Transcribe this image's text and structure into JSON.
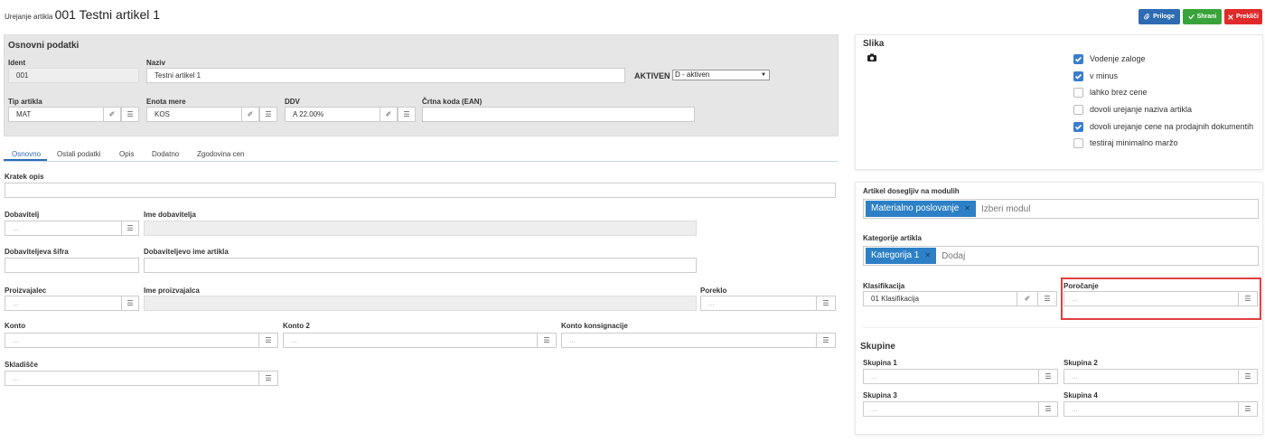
{
  "header": {
    "subtitle": "Urejanje artikla",
    "title": "001 Testni artikel 1"
  },
  "toolbar": {
    "attachments": "Priloge",
    "save": "Shrani",
    "cancel": "Prekliči"
  },
  "colors": {
    "blue": "#2d6bb3",
    "green": "#38a33a",
    "red": "#e02a2a",
    "highlight": "#e04040"
  },
  "basic": {
    "section_title": "Osnovni podatki",
    "ident_label": "Ident",
    "ident_value": "001",
    "name_label": "Naziv",
    "name_value": "Testni artikel 1",
    "active_label": "AKTIVEN",
    "active_value": "D - aktiven",
    "type_label": "Tip artikla",
    "type_value": "MAT",
    "unit_label": "Enota mere",
    "unit_value": "KOS",
    "vat_label": "DDV",
    "vat_value": "A 22.00%",
    "ean_label": "Črtna koda (EAN)",
    "ean_value": ""
  },
  "tabs": [
    "Osnovno",
    "Ostali podatki",
    "Opis",
    "Dodatno",
    "Zgodovina cen"
  ],
  "form": {
    "short_desc": "Kratek opis",
    "supplier": "Dobavitelj",
    "supplier_name": "Ime dobavitelja",
    "supplier_code": "Dobaviteljeva šifra",
    "supplier_item_name": "Dobaviteljevo ime artikla",
    "manufacturer": "Proizvajalec",
    "manufacturer_name": "Ime proizvajalca",
    "origin": "Poreklo",
    "account": "Konto",
    "account2": "Konto 2",
    "consignment_account": "Konto konsignacije",
    "warehouse": "Skladišče",
    "placeholder": "..."
  },
  "image": {
    "title": "Slika"
  },
  "checks": [
    {
      "label": "Vodenje zaloge",
      "checked": true
    },
    {
      "label": "v minus",
      "checked": true
    },
    {
      "label": "lahko brez cene",
      "checked": false
    },
    {
      "label": "dovoli urejanje naziva artikla",
      "checked": false
    },
    {
      "label": "dovoli urejanje cene na prodajnih dokumentih",
      "checked": true
    },
    {
      "label": "testiraj minimalno maržo",
      "checked": false
    }
  ],
  "modules": {
    "label": "Artikel dosegljiv na modulih",
    "tag": "Materialno poslovanje",
    "placeholder": "Izberi modul"
  },
  "categories": {
    "label": "Kategorije artikla",
    "tag": "Kategorija 1",
    "placeholder": "Dodaj"
  },
  "classification": {
    "label": "Klasifikacija",
    "value": "01 Klasifikacija"
  },
  "reporting": {
    "label": "Poročanje"
  },
  "groups": {
    "title": "Skupine",
    "g1": "Skupina 1",
    "g2": "Skupina 2",
    "g3": "Skupina 3",
    "g4": "Skupina 4"
  }
}
